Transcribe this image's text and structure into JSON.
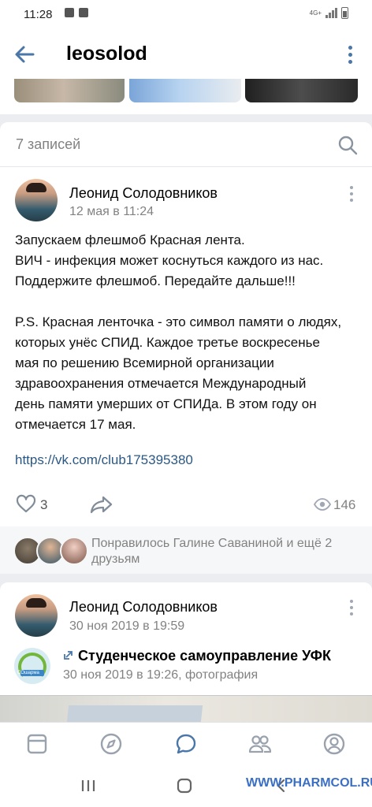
{
  "status_bar": {
    "time": "11:28",
    "network": "4G+"
  },
  "header": {
    "title": "leosolod"
  },
  "feed": {
    "count_label": "7 записей"
  },
  "post1": {
    "author": "Леонид Солодовников",
    "date": "12 мая в 11:24",
    "lines": [
      "Запускаем флешмоб Красная лента.",
      "ВИЧ - инфекция может коснуться каждого из нас.",
      "Поддержите флешмоб. Передайте дальше!!!",
      "P.S. Красная ленточка - это символ памяти о людях,",
      "которых унёс СПИД. Каждое третье воскресенье",
      "мая по решению Всемирной организации",
      "здравоохранения отмечается Международный",
      "день памяти умерших от СПИДа. В этом году он",
      "отмечается 17 мая."
    ],
    "link": "https://vk.com/club175395380",
    "likes": "3",
    "views": "146"
  },
  "likes_bar": {
    "text": "Понравилось Галине Саваниной и ещё 2 друзьям"
  },
  "post2": {
    "author": "Леонид Солодовников",
    "date": "30 ноя 2019 в 19:59",
    "repost_title": "Студенческое самоуправление УФК",
    "repost_date": "30 ноя 2019 в 19:26, фотография",
    "repost_avatar_text": "СОшарма"
  },
  "bottom_nav": {
    "icons": [
      "newsfeed-icon",
      "discover-icon",
      "messages-icon",
      "friends-icon",
      "profile-icon"
    ],
    "active": "messages-icon"
  },
  "watermark": "WWW.PHARMCOL.RU",
  "colors": {
    "accent": "#4a76a8",
    "link": "#2a5885",
    "muted": "#828282",
    "background": "#ebedf0"
  }
}
